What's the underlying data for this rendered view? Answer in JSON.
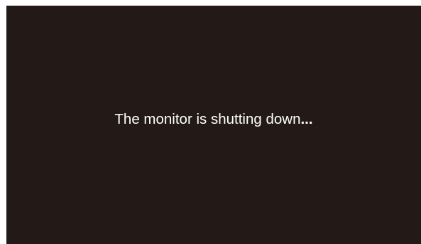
{
  "screen": {
    "message": "The monitor is shutting down",
    "ellipsis": "...",
    "background_color": "#231a18",
    "text_color": "#ffffff"
  }
}
